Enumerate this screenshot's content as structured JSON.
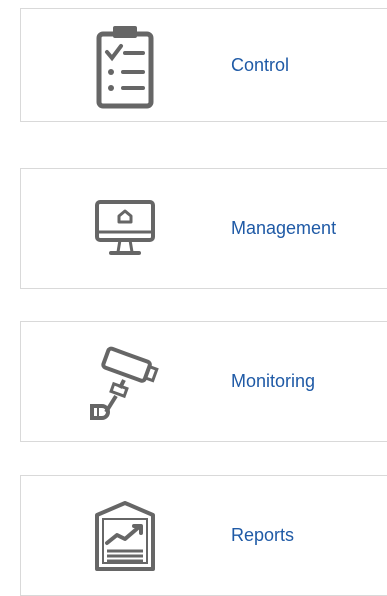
{
  "menu": {
    "items": [
      {
        "label": "Control",
        "icon": "clipboard-checklist-icon"
      },
      {
        "label": "Management",
        "icon": "monitor-home-icon"
      },
      {
        "label": "Monitoring",
        "icon": "security-camera-icon"
      },
      {
        "label": "Reports",
        "icon": "report-chart-icon"
      }
    ]
  },
  "colors": {
    "link": "#1f5aa6",
    "icon": "#666666",
    "border": "#d9d9d9"
  }
}
